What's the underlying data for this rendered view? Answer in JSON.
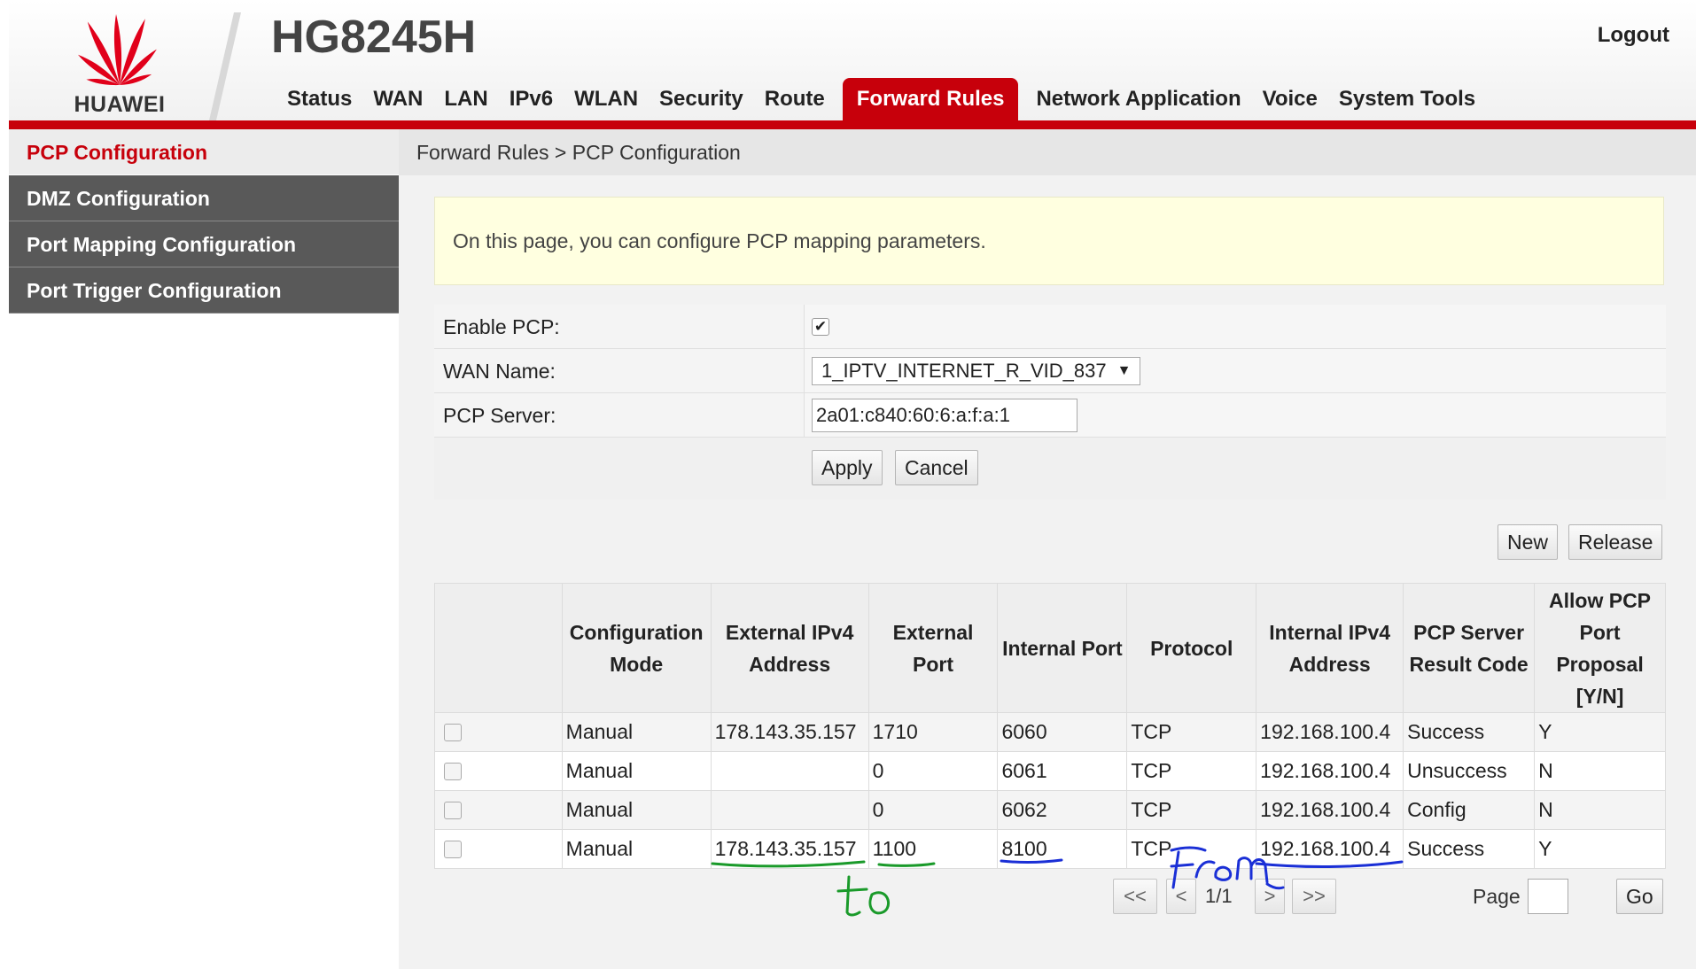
{
  "header": {
    "brand": "HUAWEI",
    "product": "HG8245H",
    "logout": "Logout",
    "nav": [
      "Status",
      "WAN",
      "LAN",
      "IPv6",
      "WLAN",
      "Security",
      "Route",
      "Forward Rules",
      "Network Application",
      "Voice",
      "System Tools"
    ],
    "active_nav": "Forward Rules"
  },
  "sidebar": {
    "items": [
      "PCP Configuration",
      "DMZ Configuration",
      "Port Mapping Configuration",
      "Port Trigger Configuration"
    ],
    "active": "PCP Configuration"
  },
  "breadcrumb": "Forward Rules > PCP Configuration",
  "notice": "On this page, you can configure PCP mapping parameters.",
  "form": {
    "enable_label": "Enable PCP:",
    "enable_checked": true,
    "wan_label": "WAN Name:",
    "wan_value": "1_IPTV_INTERNET_R_VID_837",
    "server_label": "PCP Server:",
    "server_value": "2a01:c840:60:6:a:f:a:1",
    "apply": "Apply",
    "cancel": "Cancel"
  },
  "actions": {
    "new": "New",
    "release": "Release"
  },
  "table": {
    "headers": [
      "",
      "Configuration Mode",
      "External IPv4 Address",
      "External Port",
      "Internal Port",
      "Protocol",
      "Internal IPv4 Address",
      "PCP Server Result Code",
      "Allow PCP Port Proposal [Y/N]"
    ],
    "rows": [
      [
        "Manual",
        "178.143.35.157",
        "1710",
        "6060",
        "TCP",
        "192.168.100.4",
        "Success",
        "Y"
      ],
      [
        "Manual",
        "",
        "0",
        "6061",
        "TCP",
        "192.168.100.4",
        "Unsuccess",
        "N"
      ],
      [
        "Manual",
        "",
        "0",
        "6062",
        "TCP",
        "192.168.100.4",
        "Config",
        "N"
      ],
      [
        "Manual",
        "178.143.35.157",
        "1100",
        "8100",
        "TCP",
        "192.168.100.4",
        "Success",
        "Y"
      ]
    ]
  },
  "pagination": {
    "first": "<<",
    "prev": "<",
    "info": "1/1",
    "next": ">",
    "last": ">>",
    "page_label": "Page",
    "go": "Go"
  },
  "annotations": {
    "green_text": "to",
    "blue_text": "from",
    "green_color": "#1a9a2a",
    "blue_color": "#1a2fd6"
  }
}
